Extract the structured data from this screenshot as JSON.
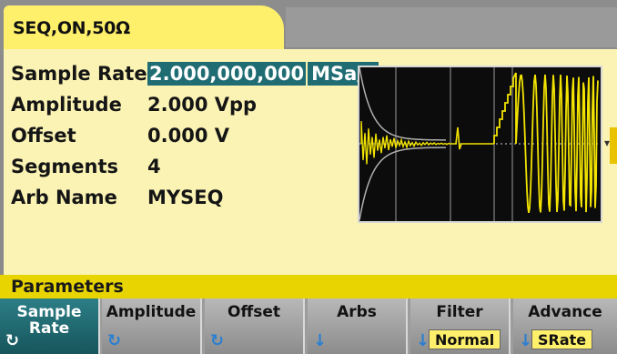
{
  "tab": {
    "label": "SEQ,ON,50Ω"
  },
  "params": [
    {
      "label": "Sample Rate",
      "value_main": "2.000,000,000",
      "value_cursor": "",
      "unit": "MSa/s"
    },
    {
      "label": "Amplitude",
      "value": "2.000 Vpp"
    },
    {
      "label": "Offset",
      "value": "0.000 V"
    },
    {
      "label": "Segments",
      "value": "4"
    },
    {
      "label": "Arb Name",
      "value": "MYSEQ"
    }
  ],
  "menu_title": "Parameters",
  "softkeys": [
    {
      "label": "Sample\nRate",
      "icon": "knob-icon",
      "value": ""
    },
    {
      "label": "Amplitude",
      "icon": "knob-icon",
      "value": ""
    },
    {
      "label": "Offset",
      "icon": "knob-icon",
      "value": ""
    },
    {
      "label": "Arbs",
      "icon": "down-arrow-icon",
      "value": ""
    },
    {
      "label": "Filter",
      "icon": "down-arrow-icon",
      "value": "Normal"
    },
    {
      "label": "Advance",
      "icon": "down-arrow-icon",
      "value": "SRate"
    }
  ],
  "colors": {
    "accent": "#fff06b",
    "selection": "#1f6d73",
    "trace": "#f2e300"
  }
}
